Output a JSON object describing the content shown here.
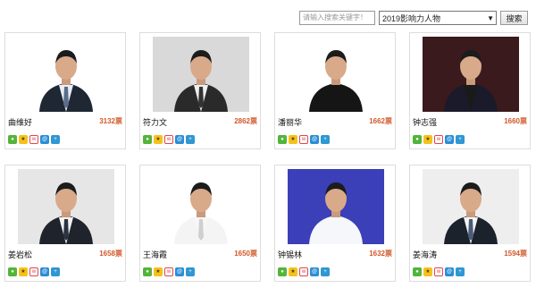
{
  "search": {
    "placeholder": "请输入搜索关键字！",
    "year_select": "2019影响力人物",
    "button_label": "搜索"
  },
  "people": [
    {
      "name": "曲维好",
      "votes": "3132票",
      "bg": "#ffffff",
      "suit": "#1f2733",
      "shirt": "#e8eef5",
      "tie": "#5a6d8a"
    },
    {
      "name": "符力文",
      "votes": "2862票",
      "bg": "#d9d9d9",
      "suit": "#2a2a2a",
      "shirt": "#efefef",
      "tie": "#333333"
    },
    {
      "name": "潘丽华",
      "votes": "1662票",
      "bg": "#ffffff",
      "suit": "#151515",
      "shirt": "#151515",
      "tie": "#151515"
    },
    {
      "name": "钟志强",
      "votes": "1660票",
      "bg": "#3a1a1c",
      "suit": "#1a1a2a",
      "shirt": "#1a1a1a",
      "tie": "#1a1a1a"
    },
    {
      "name": "姜岩松",
      "votes": "1658票",
      "bg": "#e6e6e6",
      "suit": "#1e232c",
      "shirt": "#f2f2f2",
      "tie": "#2b3240"
    },
    {
      "name": "王海霞",
      "votes": "1650票",
      "bg": "#ffffff",
      "suit": "#f4f4f4",
      "shirt": "#f7f7f7",
      "tie": "#cfcfcf"
    },
    {
      "name": "钟锡林",
      "votes": "1632票",
      "bg": "#3b3fb8",
      "suit": "#f5f7fb",
      "shirt": "#f5f7fb",
      "tie": "#f5f7fb"
    },
    {
      "name": "姜海涛",
      "votes": "1594票",
      "bg": "#eeeeee",
      "suit": "#1c222c",
      "shirt": "#f4f4f4",
      "tie": "#4a5a78"
    }
  ],
  "share_icons": [
    "wechat-icon",
    "qzone-icon",
    "weibo-icon",
    "tencent-weibo-icon",
    "more-icon"
  ]
}
